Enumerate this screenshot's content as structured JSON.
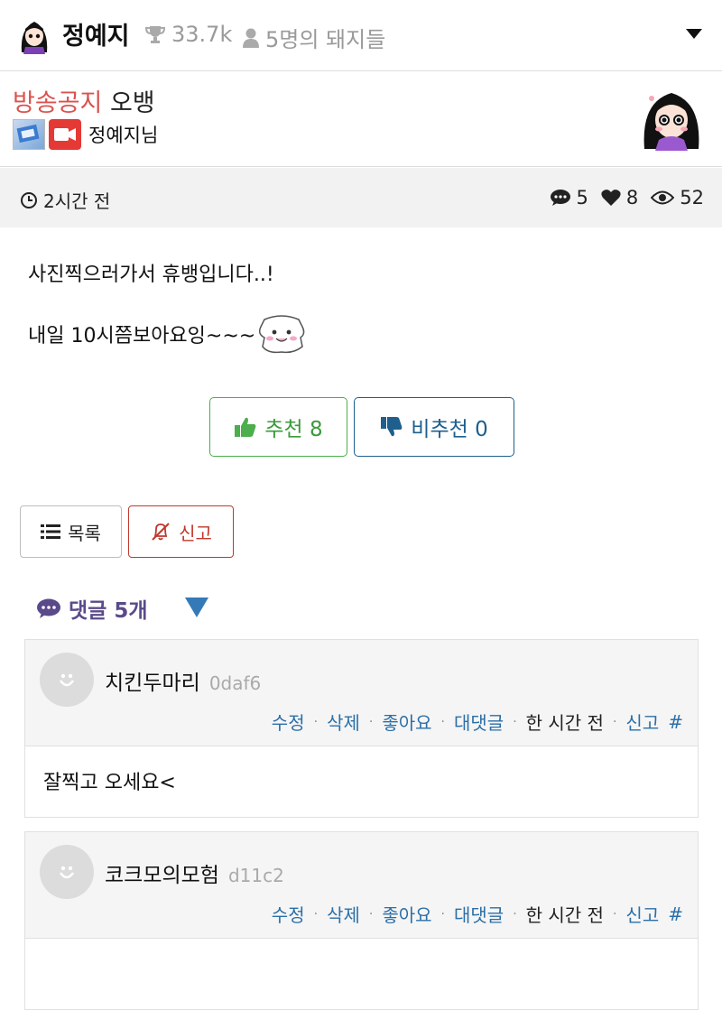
{
  "header": {
    "streamer_name": "정예지",
    "trophy_count": "33.7k",
    "fan_count": "5명의 돼지들",
    "icons": [
      "avatar",
      "trophy-icon",
      "user-icon",
      "caret-down-icon"
    ]
  },
  "post": {
    "category": "방송공지",
    "title": "오뱅",
    "author": "정예지님",
    "time": "2시간 전",
    "comment_count": "5",
    "like_count": "8",
    "view_count": "52",
    "line1": "사진찍으러가서 휴뱅입니다..!",
    "line2": "내일 10시쯤보아요잉~~~",
    "upvote_label": "추천 8",
    "downvote_label": "비추천 0"
  },
  "actions": {
    "list_label": "목록",
    "report_label": "신고"
  },
  "comments_section": {
    "title": "댓글 5개"
  },
  "comments": [
    {
      "name": "치킨두마리",
      "id": "0daf6",
      "actions": [
        "수정",
        "삭제",
        "좋아요",
        "대댓글"
      ],
      "time": "한 시간 전",
      "report": "신고",
      "hash": "#",
      "text": "잘찍고 오세요<"
    },
    {
      "name": "코크모의모험",
      "id": "d11c2",
      "actions": [
        "수정",
        "삭제",
        "좋아요",
        "대댓글"
      ],
      "time": "한 시간 전",
      "report": "신고",
      "hash": "#",
      "text": ""
    }
  ],
  "colors": {
    "category": "#d9534f",
    "upvote": "#4cae4c",
    "downvote": "#1e5f8e",
    "report": "#c0392b",
    "comments_title": "#5a4a8a",
    "link": "#2b6fa8"
  }
}
